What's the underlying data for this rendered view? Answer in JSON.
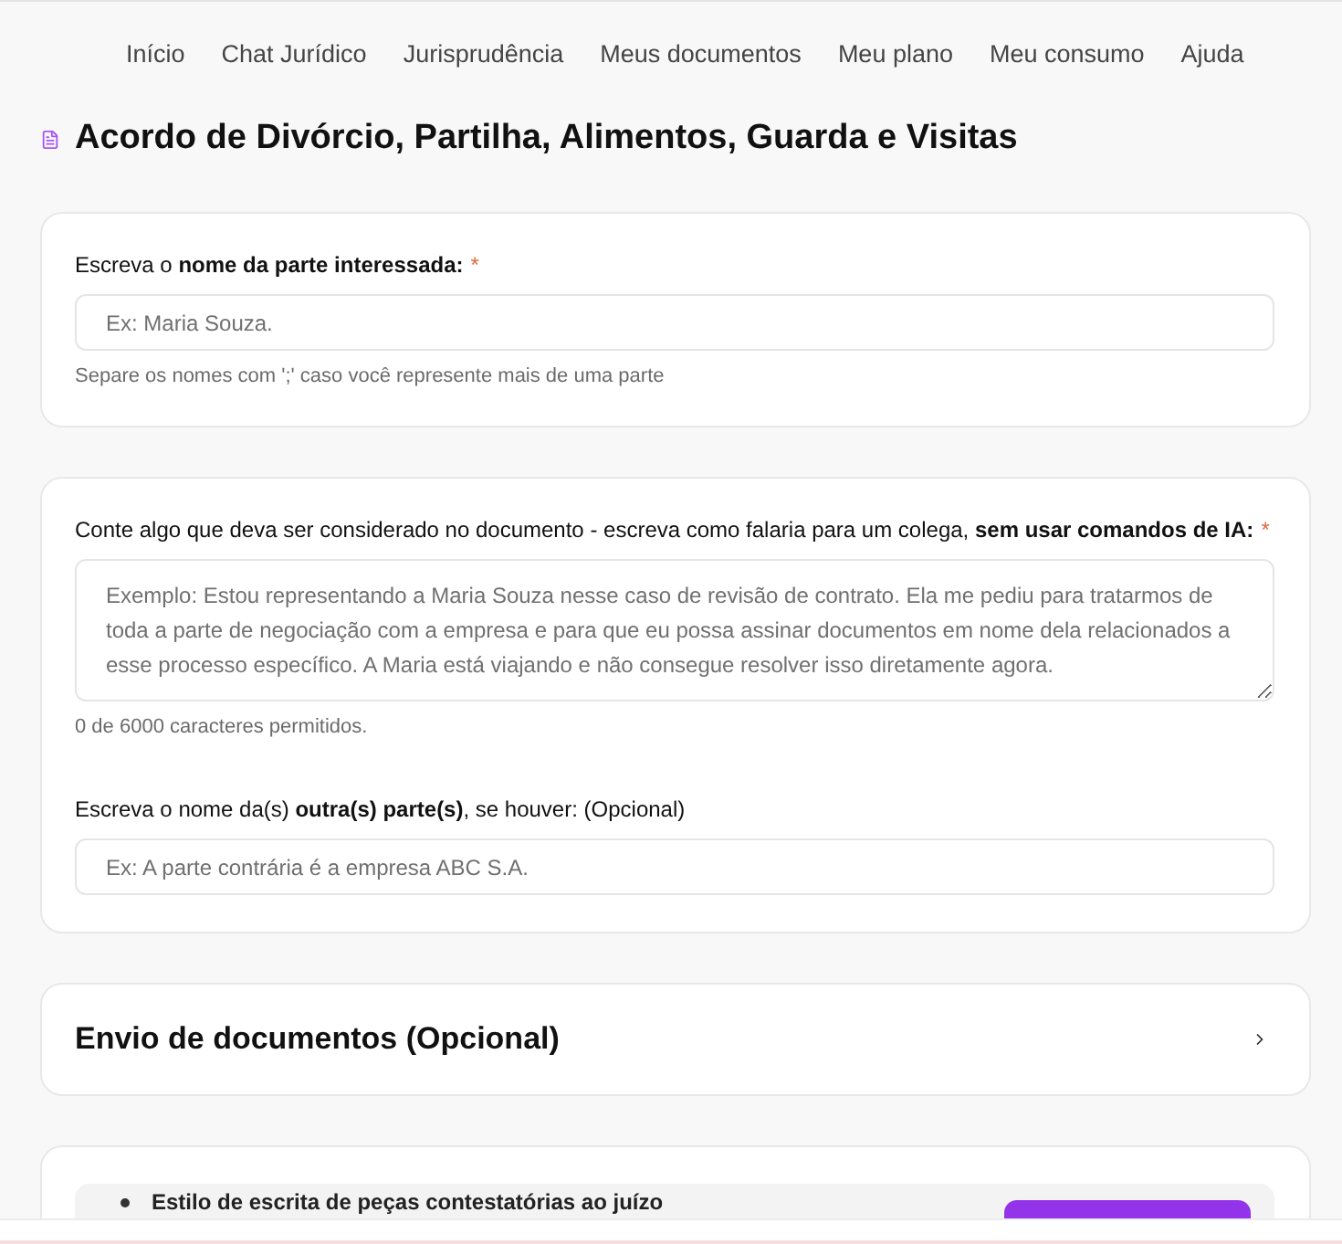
{
  "nav": {
    "items": [
      {
        "label": "Início"
      },
      {
        "label": "Chat Jurídico"
      },
      {
        "label": "Jurisprudência"
      },
      {
        "label": "Meus documentos"
      },
      {
        "label": "Meu plano"
      },
      {
        "label": "Meu consumo"
      },
      {
        "label": "Ajuda"
      }
    ]
  },
  "page_title": "Acordo de Divórcio, Partilha, Alimentos, Guarda e Visitas",
  "sections": [
    {
      "kind": "form",
      "fields": [
        {
          "kind": "input",
          "label": "Escreva o **nome da parte interessada:**",
          "required_mark": "*",
          "placeholder": "Ex: Maria Souza.",
          "helper": "Separe os nomes com ';' caso você represente mais de uma parte"
        }
      ]
    },
    {
      "kind": "form",
      "fields": [
        {
          "kind": "textarea",
          "label": "Conte algo que deva ser considerado no documento - escreva como falaria para um colega, **sem usar comandos de IA:**",
          "required_mark": "*",
          "placeholder": "Exemplo: Estou representando a Maria Souza nesse caso de revisão de contrato. Ela me pediu para tratarmos de toda a parte de negociação com a empresa e para que eu possa assinar documentos em nome dela relacionados a esse processo específico. A Maria está viajando e não consegue resolver isso diretamente agora.",
          "helper": "0 de 6000 caracteres permitidos."
        },
        {
          "kind": "input",
          "label": "Escreva o nome da(s) **outra(s) parte(s)**, se houver: (Opcional)",
          "placeholder": "Ex: A parte contrária é a empresa ABC S.A."
        }
      ]
    },
    {
      "kind": "accordion",
      "title": "Envio de documentos (Opcional)",
      "expanded": false
    },
    {
      "kind": "options",
      "items": [
        {
          "label": "Estilo de escrita de peças contestatórias ao juízo"
        }
      ]
    }
  ]
}
